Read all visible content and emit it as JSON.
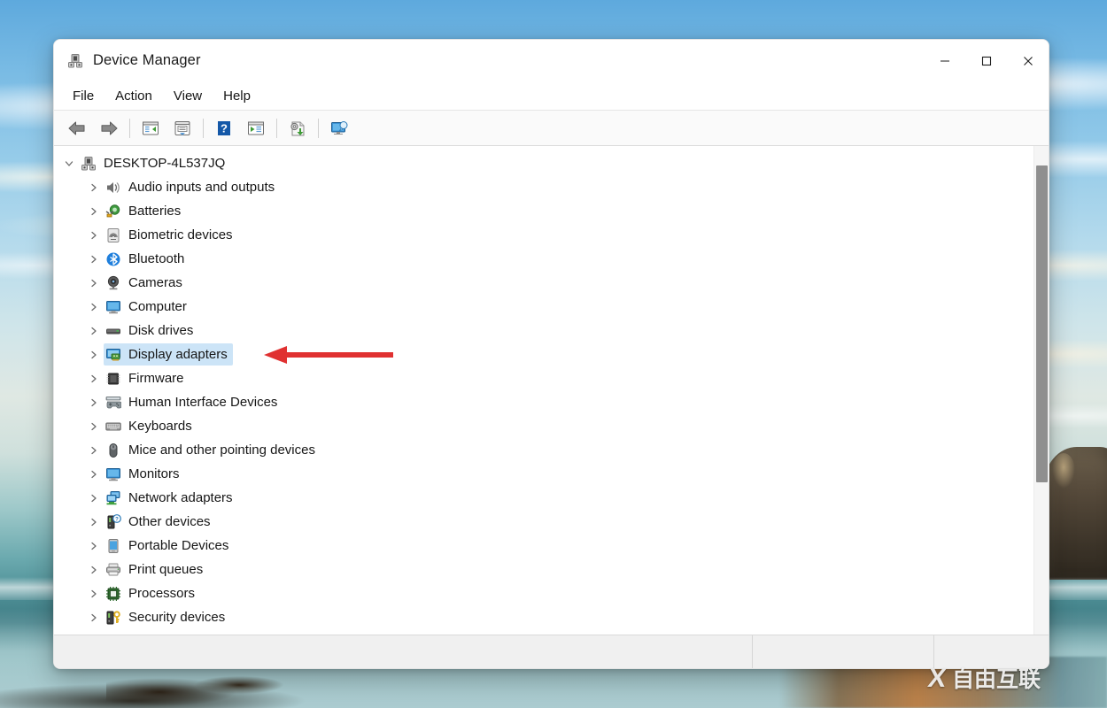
{
  "window": {
    "title": "Device Manager",
    "icon": "device-manager-icon",
    "controls": {
      "minimize": "minimize-icon",
      "maximize": "maximize-icon",
      "close": "close-icon"
    }
  },
  "menubar": {
    "items": [
      {
        "label": "File",
        "name": "menu-file"
      },
      {
        "label": "Action",
        "name": "menu-action"
      },
      {
        "label": "View",
        "name": "menu-view"
      },
      {
        "label": "Help",
        "name": "menu-help"
      }
    ]
  },
  "toolbar": {
    "buttons": [
      {
        "name": "back-button",
        "icon": "back-arrow-icon",
        "tooltip": "Back"
      },
      {
        "name": "forward-button",
        "icon": "forward-arrow-icon",
        "tooltip": "Forward"
      },
      {
        "name": "show-hide-tree-button",
        "icon": "console-tree-icon",
        "tooltip": "Show/Hide Console Tree"
      },
      {
        "name": "properties-button",
        "icon": "properties-icon",
        "tooltip": "Properties"
      },
      {
        "name": "help-button",
        "icon": "help-question-icon",
        "tooltip": "Help"
      },
      {
        "name": "scan-hardware-button",
        "icon": "scan-changes-icon",
        "tooltip": "Scan for hardware changes"
      },
      {
        "name": "update-driver-button",
        "icon": "update-driver-icon",
        "tooltip": "Update driver"
      },
      {
        "name": "remote-display-button",
        "icon": "remote-display-icon",
        "tooltip": "Display"
      }
    ]
  },
  "tree": {
    "root": {
      "label": "DESKTOP-4L537JQ",
      "icon": "computer-node-icon",
      "expanded": true,
      "chevron": "chevron-down-icon"
    },
    "items": [
      {
        "label": "Audio inputs and outputs",
        "icon": "speaker-icon",
        "selected": false
      },
      {
        "label": "Batteries",
        "icon": "battery-icon",
        "selected": false
      },
      {
        "label": "Biometric devices",
        "icon": "fingerprint-icon",
        "selected": false
      },
      {
        "label": "Bluetooth",
        "icon": "bluetooth-icon",
        "selected": false
      },
      {
        "label": "Cameras",
        "icon": "camera-icon",
        "selected": false
      },
      {
        "label": "Computer",
        "icon": "monitor-icon",
        "selected": false
      },
      {
        "label": "Disk drives",
        "icon": "disk-drive-icon",
        "selected": false
      },
      {
        "label": "Display adapters",
        "icon": "display-adapter-icon",
        "selected": true
      },
      {
        "label": "Firmware",
        "icon": "firmware-chip-icon",
        "selected": false
      },
      {
        "label": "Human Interface Devices",
        "icon": "gamepad-icon",
        "selected": false
      },
      {
        "label": "Keyboards",
        "icon": "keyboard-icon",
        "selected": false
      },
      {
        "label": "Mice and other pointing devices",
        "icon": "mouse-icon",
        "selected": false
      },
      {
        "label": "Monitors",
        "icon": "monitor-icon",
        "selected": false
      },
      {
        "label": "Network adapters",
        "icon": "network-adapter-icon",
        "selected": false
      },
      {
        "label": "Other devices",
        "icon": "unknown-device-icon",
        "selected": false
      },
      {
        "label": "Portable Devices",
        "icon": "portable-device-icon",
        "selected": false
      },
      {
        "label": "Print queues",
        "icon": "printer-icon",
        "selected": false
      },
      {
        "label": "Processors",
        "icon": "processor-icon",
        "selected": false
      },
      {
        "label": "Security devices",
        "icon": "security-key-icon",
        "selected": false
      }
    ],
    "child_chevron": "chevron-right-icon"
  },
  "statusbar": {
    "main": "",
    "section2": "",
    "section3": ""
  },
  "annotation": {
    "arrow": {
      "name": "red-pointer-arrow",
      "points_to": "Display adapters",
      "direction": "left",
      "color": "#e03131"
    }
  },
  "watermark": {
    "logo": "X",
    "text": "自由互联"
  },
  "colors": {
    "selection": "#cce4f7",
    "annotation_red": "#e03131",
    "titlebar_bg": "#ffffff",
    "toolbar_bg": "#fafafa",
    "statusbar_bg": "#f0f0f0",
    "scrollbar_thumb": "#8f8f8f"
  }
}
